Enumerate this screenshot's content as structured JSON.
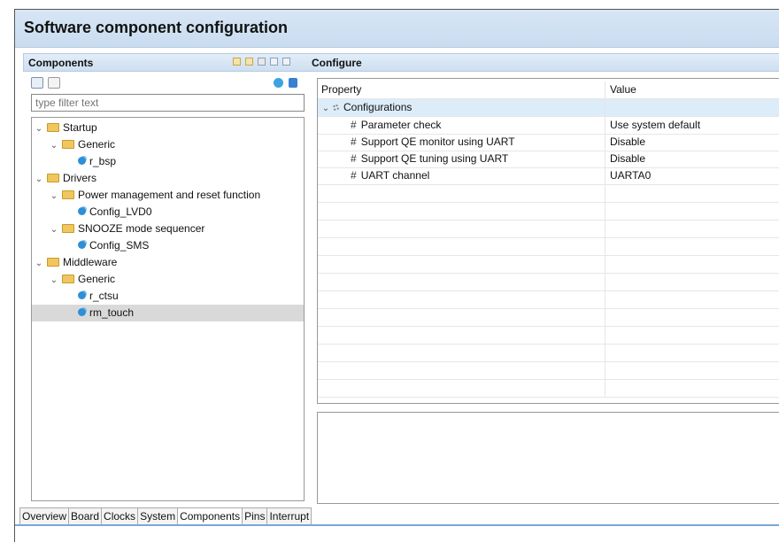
{
  "window": {
    "title": "Software component configuration"
  },
  "components_panel": {
    "title": "Components",
    "filter_placeholder": "type filter text",
    "tree": [
      {
        "label": "Startup",
        "level": 0,
        "kind": "folder",
        "expanded": true
      },
      {
        "label": "Generic",
        "level": 1,
        "kind": "folder",
        "expanded": true
      },
      {
        "label": "r_bsp",
        "level": 2,
        "kind": "component"
      },
      {
        "label": "Drivers",
        "level": 0,
        "kind": "folder",
        "expanded": true
      },
      {
        "label": "Power management and reset function",
        "level": 1,
        "kind": "folder",
        "expanded": true
      },
      {
        "label": "Config_LVD0",
        "level": 2,
        "kind": "component"
      },
      {
        "label": "SNOOZE mode sequencer",
        "level": 1,
        "kind": "folder",
        "expanded": true
      },
      {
        "label": "Config_SMS",
        "level": 2,
        "kind": "component"
      },
      {
        "label": "Middleware",
        "level": 0,
        "kind": "folder",
        "expanded": true
      },
      {
        "label": "Generic",
        "level": 1,
        "kind": "folder",
        "expanded": true
      },
      {
        "label": "r_ctsu",
        "level": 2,
        "kind": "component"
      },
      {
        "label": "rm_touch",
        "level": 2,
        "kind": "component",
        "selected": true
      }
    ]
  },
  "configure_panel": {
    "title": "Configure",
    "columns": [
      "Property",
      "Value"
    ],
    "group": "Configurations",
    "properties": [
      {
        "name": "Parameter check",
        "value": "Use system default"
      },
      {
        "name": "Support QE monitor using UART",
        "value": "Disable"
      },
      {
        "name": "Support QE tuning using UART",
        "value": "Disable"
      },
      {
        "name": "UART channel",
        "value": "UARTA0"
      }
    ]
  },
  "tabs": [
    "Overview",
    "Board",
    "Clocks",
    "System",
    "Components",
    "Pins",
    "Interrupt"
  ],
  "active_tab": "Components",
  "colors": {
    "header_bg": "#c9dcf0",
    "selection": "#d9d9d9",
    "group_row": "#dcecf9"
  }
}
